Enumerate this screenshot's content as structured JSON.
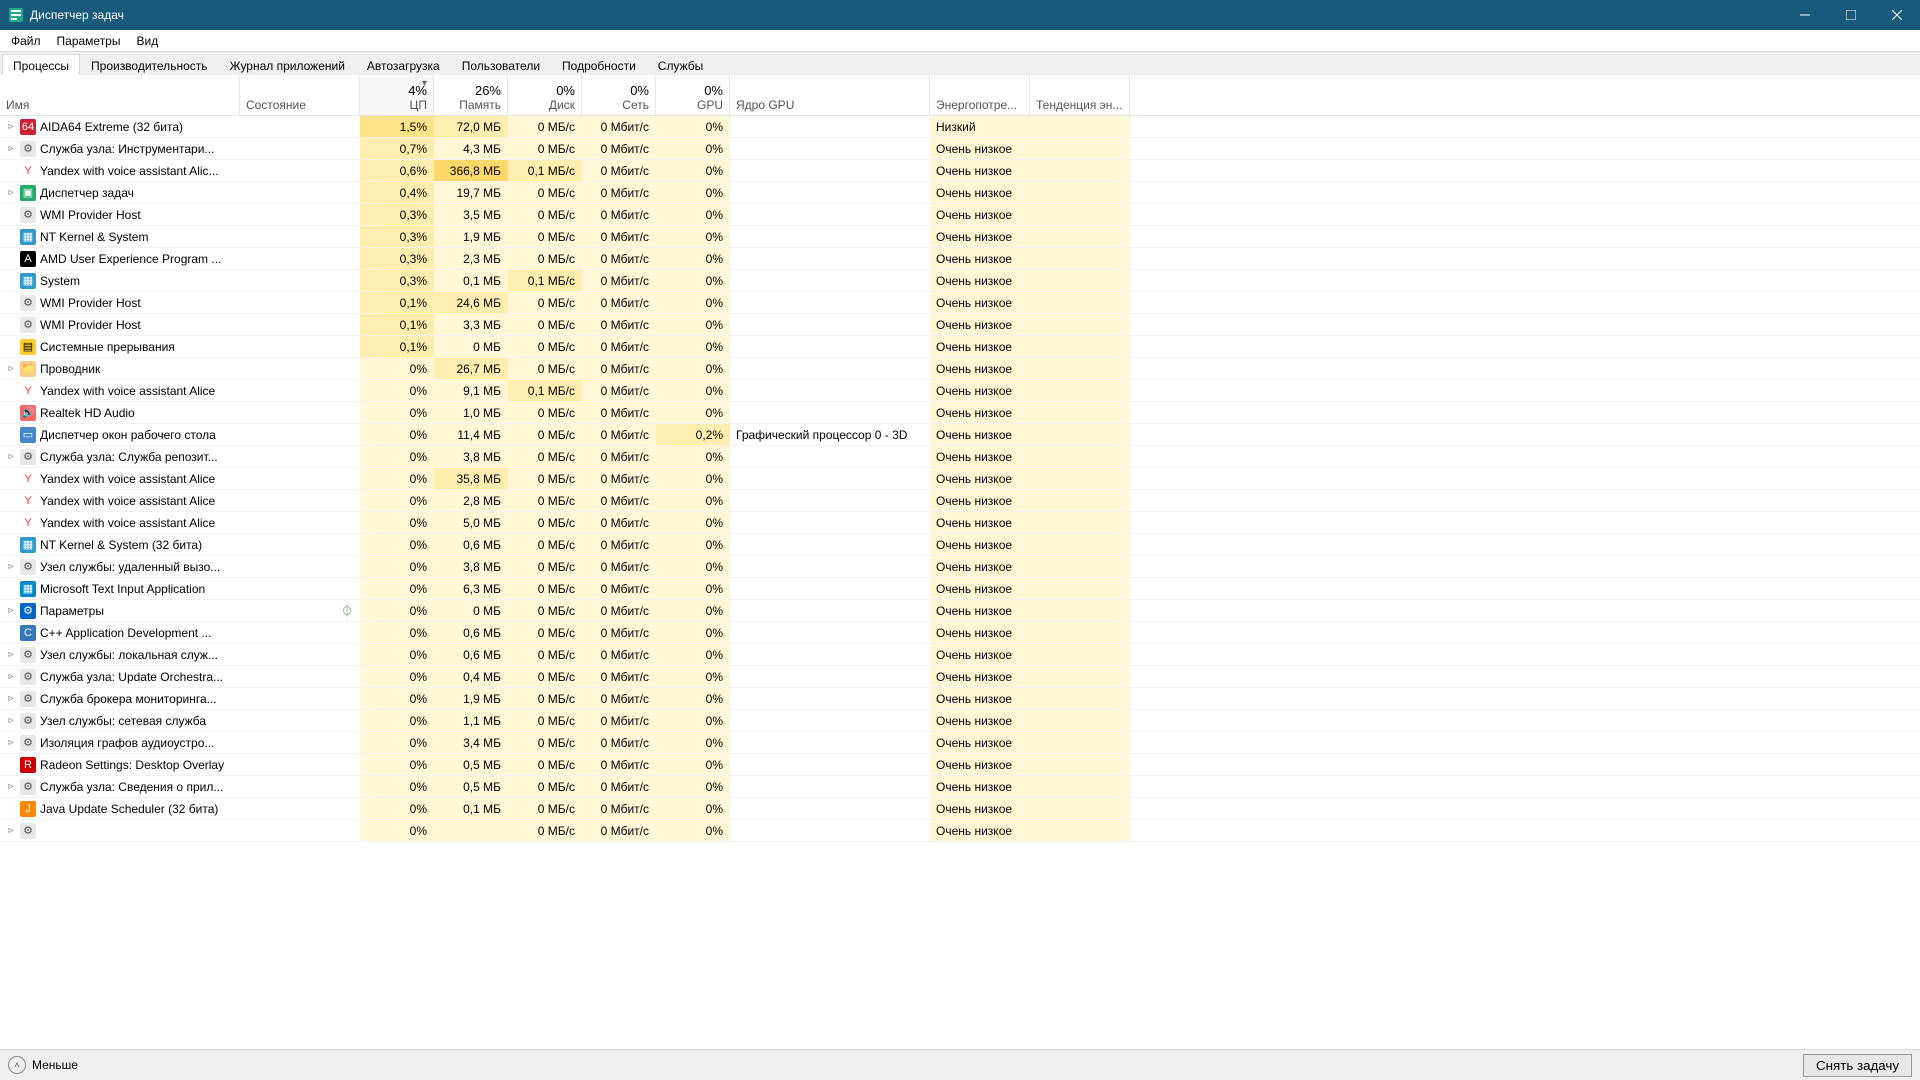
{
  "window": {
    "title": "Диспетчер задач"
  },
  "menu": {
    "file": "Файл",
    "options": "Параметры",
    "view": "Вид"
  },
  "tabs": {
    "processes": "Процессы",
    "performance": "Производительность",
    "app_history": "Журнал приложений",
    "startup": "Автозагрузка",
    "users": "Пользователи",
    "details": "Подробности",
    "services": "Службы"
  },
  "columns": {
    "name": "Имя",
    "status": "Состояние",
    "cpu_hdr": "4%",
    "cpu": "ЦП",
    "mem_hdr": "26%",
    "mem": "Память",
    "disk_hdr": "0%",
    "disk": "Диск",
    "net_hdr": "0%",
    "net": "Сеть",
    "gpu_hdr": "0%",
    "gpu": "GPU",
    "gpu_engine": "Ядро GPU",
    "power": "Энергопотре...",
    "trend": "Тенденция эн..."
  },
  "footer": {
    "fewer": "Меньше",
    "end_task": "Снять задачу"
  },
  "power_labels": {
    "low": "Низкий",
    "very_low": "Очень низкое"
  },
  "rows": [
    {
      "exp": true,
      "icon": "aida",
      "name": "AIDA64 Extreme (32 бита)",
      "cpu": "1,5%",
      "cpu_h": 2,
      "mem": "72,0 МБ",
      "mem_h": 1,
      "disk": "0 МБ/с",
      "net": "0 Мбит/с",
      "gpu": "0%",
      "gpueng": "",
      "pow": "low"
    },
    {
      "exp": true,
      "icon": "svc",
      "name": "Служба узла: Инструментари...",
      "cpu": "0,7%",
      "cpu_h": 1,
      "mem": "4,3 МБ",
      "disk": "0 МБ/с",
      "net": "0 Мбит/с",
      "gpu": "0%",
      "gpueng": "",
      "pow": "very_low"
    },
    {
      "exp": false,
      "icon": "yandex",
      "name": "Yandex with voice assistant Alic...",
      "cpu": "0,6%",
      "cpu_h": 1,
      "mem": "366,8 МБ",
      "mem_h": 3,
      "disk": "0,1 МБ/с",
      "disk_h": 1,
      "net": "0 Мбит/с",
      "gpu": "0%",
      "gpueng": "",
      "pow": "very_low"
    },
    {
      "exp": true,
      "icon": "tm",
      "name": "Диспетчер задач",
      "cpu": "0,4%",
      "cpu_h": 1,
      "mem": "19,7 МБ",
      "disk": "0 МБ/с",
      "net": "0 Мбит/с",
      "gpu": "0%",
      "gpueng": "",
      "pow": "very_low"
    },
    {
      "exp": false,
      "icon": "svc",
      "name": "WMI Provider Host",
      "cpu": "0,3%",
      "cpu_h": 1,
      "mem": "3,5 МБ",
      "disk": "0 МБ/с",
      "net": "0 Мбит/с",
      "gpu": "0%",
      "gpueng": "",
      "pow": "very_low"
    },
    {
      "exp": false,
      "icon": "sys",
      "name": "NT Kernel & System",
      "cpu": "0,3%",
      "cpu_h": 1,
      "mem": "1,9 МБ",
      "disk": "0 МБ/с",
      "net": "0 Мбит/с",
      "gpu": "0%",
      "gpueng": "",
      "pow": "very_low"
    },
    {
      "exp": false,
      "icon": "amd",
      "name": "AMD User Experience Program ...",
      "cpu": "0,3%",
      "cpu_h": 1,
      "mem": "2,3 МБ",
      "disk": "0 МБ/с",
      "net": "0 Мбит/с",
      "gpu": "0%",
      "gpueng": "",
      "pow": "very_low"
    },
    {
      "exp": false,
      "icon": "sys",
      "name": "System",
      "cpu": "0,3%",
      "cpu_h": 1,
      "mem": "0,1 МБ",
      "disk": "0,1 МБ/с",
      "disk_h": 1,
      "net": "0 Мбит/с",
      "gpu": "0%",
      "gpueng": "",
      "pow": "very_low"
    },
    {
      "exp": false,
      "icon": "svc",
      "name": "WMI Provider Host",
      "cpu": "0,1%",
      "cpu_h": 1,
      "mem": "24,6 МБ",
      "mem_h": 1,
      "disk": "0 МБ/с",
      "net": "0 Мбит/с",
      "gpu": "0%",
      "gpueng": "",
      "pow": "very_low"
    },
    {
      "exp": false,
      "icon": "svc",
      "name": "WMI Provider Host",
      "cpu": "0,1%",
      "cpu_h": 1,
      "mem": "3,3 МБ",
      "disk": "0 МБ/с",
      "net": "0 Мбит/с",
      "gpu": "0%",
      "gpueng": "",
      "pow": "very_low"
    },
    {
      "exp": false,
      "icon": "int",
      "name": "Системные прерывания",
      "cpu": "0,1%",
      "cpu_h": 1,
      "mem": "0 МБ",
      "disk": "0 МБ/с",
      "net": "0 Мбит/с",
      "gpu": "0%",
      "gpueng": "",
      "pow": "very_low"
    },
    {
      "exp": true,
      "icon": "explorer",
      "name": "Проводник",
      "cpu": "0%",
      "mem": "26,7 МБ",
      "mem_h": 1,
      "disk": "0 МБ/с",
      "net": "0 Мбит/с",
      "gpu": "0%",
      "gpueng": "",
      "pow": "very_low"
    },
    {
      "exp": false,
      "icon": "yandex",
      "name": "Yandex with voice assistant Alice",
      "cpu": "0%",
      "mem": "9,1 МБ",
      "disk": "0,1 МБ/с",
      "disk_h": 1,
      "net": "0 Мбит/с",
      "gpu": "0%",
      "gpueng": "",
      "pow": "very_low"
    },
    {
      "exp": false,
      "icon": "realtek",
      "name": "Realtek HD Audio",
      "cpu": "0%",
      "mem": "1,0 МБ",
      "disk": "0 МБ/с",
      "net": "0 Мбит/с",
      "gpu": "0%",
      "gpueng": "",
      "pow": "very_low"
    },
    {
      "exp": false,
      "icon": "dwm",
      "name": "Диспетчер окон рабочего стола",
      "cpu": "0%",
      "mem": "11,4 МБ",
      "disk": "0 МБ/с",
      "net": "0 Мбит/с",
      "gpu": "0,2%",
      "gpu_h": 1,
      "gpueng": "Графический процессор 0 - 3D",
      "pow": "very_low"
    },
    {
      "exp": true,
      "icon": "svc",
      "name": "Служба узла: Служба репозит...",
      "cpu": "0%",
      "mem": "3,8 МБ",
      "disk": "0 МБ/с",
      "net": "0 Мбит/с",
      "gpu": "0%",
      "gpueng": "",
      "pow": "very_low"
    },
    {
      "exp": false,
      "icon": "yandex",
      "name": "Yandex with voice assistant Alice",
      "cpu": "0%",
      "mem": "35,8 МБ",
      "mem_h": 1,
      "disk": "0 МБ/с",
      "net": "0 Мбит/с",
      "gpu": "0%",
      "gpueng": "",
      "pow": "very_low"
    },
    {
      "exp": false,
      "icon": "yandex",
      "name": "Yandex with voice assistant Alice",
      "cpu": "0%",
      "mem": "2,8 МБ",
      "disk": "0 МБ/с",
      "net": "0 Мбит/с",
      "gpu": "0%",
      "gpueng": "",
      "pow": "very_low"
    },
    {
      "exp": false,
      "icon": "yandex",
      "name": "Yandex with voice assistant Alice",
      "cpu": "0%",
      "mem": "5,0 МБ",
      "disk": "0 МБ/с",
      "net": "0 Мбит/с",
      "gpu": "0%",
      "gpueng": "",
      "pow": "very_low"
    },
    {
      "exp": false,
      "icon": "sys",
      "name": "NT Kernel & System (32 бита)",
      "cpu": "0%",
      "mem": "0,6 МБ",
      "disk": "0 МБ/с",
      "net": "0 Мбит/с",
      "gpu": "0%",
      "gpueng": "",
      "pow": "very_low"
    },
    {
      "exp": true,
      "icon": "svc",
      "name": "Узел службы: удаленный вызо...",
      "cpu": "0%",
      "mem": "3,8 МБ",
      "disk": "0 МБ/с",
      "net": "0 Мбит/с",
      "gpu": "0%",
      "gpueng": "",
      "pow": "very_low"
    },
    {
      "exp": false,
      "icon": "ms",
      "name": "Microsoft Text Input Application",
      "cpu": "0%",
      "mem": "6,3 МБ",
      "disk": "0 МБ/с",
      "net": "0 Мбит/с",
      "gpu": "0%",
      "gpueng": "",
      "pow": "very_low"
    },
    {
      "exp": true,
      "icon": "settings",
      "name": "Параметры",
      "leaf": true,
      "cpu": "0%",
      "mem": "0 МБ",
      "disk": "0 МБ/с",
      "net": "0 Мбит/с",
      "gpu": "0%",
      "gpueng": "",
      "pow": "very_low"
    },
    {
      "exp": false,
      "icon": "cpp",
      "name": "C++ Application Development ...",
      "cpu": "0%",
      "mem": "0,6 МБ",
      "disk": "0 МБ/с",
      "net": "0 Мбит/с",
      "gpu": "0%",
      "gpueng": "",
      "pow": "very_low"
    },
    {
      "exp": true,
      "icon": "svc",
      "name": "Узел службы: локальная служ...",
      "cpu": "0%",
      "mem": "0,6 МБ",
      "disk": "0 МБ/с",
      "net": "0 Мбит/с",
      "gpu": "0%",
      "gpueng": "",
      "pow": "very_low"
    },
    {
      "exp": true,
      "icon": "svc",
      "name": "Служба узла: Update Orchestra...",
      "cpu": "0%",
      "mem": "0,4 МБ",
      "disk": "0 МБ/с",
      "net": "0 Мбит/с",
      "gpu": "0%",
      "gpueng": "",
      "pow": "very_low"
    },
    {
      "exp": true,
      "icon": "svc",
      "name": "Служба брокера мониторинга...",
      "cpu": "0%",
      "mem": "1,9 МБ",
      "disk": "0 МБ/с",
      "net": "0 Мбит/с",
      "gpu": "0%",
      "gpueng": "",
      "pow": "very_low"
    },
    {
      "exp": true,
      "icon": "svc",
      "name": "Узел службы: сетевая служба",
      "cpu": "0%",
      "mem": "1,1 МБ",
      "disk": "0 МБ/с",
      "net": "0 Мбит/с",
      "gpu": "0%",
      "gpueng": "",
      "pow": "very_low"
    },
    {
      "exp": true,
      "icon": "svc",
      "name": "Изоляция графов аудиоустро...",
      "cpu": "0%",
      "mem": "3,4 МБ",
      "disk": "0 МБ/с",
      "net": "0 Мбит/с",
      "gpu": "0%",
      "gpueng": "",
      "pow": "very_low"
    },
    {
      "exp": false,
      "icon": "radeon",
      "name": "Radeon Settings: Desktop Overlay",
      "cpu": "0%",
      "mem": "0,5 МБ",
      "disk": "0 МБ/с",
      "net": "0 Мбит/с",
      "gpu": "0%",
      "gpueng": "",
      "pow": "very_low"
    },
    {
      "exp": true,
      "icon": "svc",
      "name": "Служба узла: Сведения о прил...",
      "cpu": "0%",
      "mem": "0,5 МБ",
      "disk": "0 МБ/с",
      "net": "0 Мбит/с",
      "gpu": "0%",
      "gpueng": "",
      "pow": "very_low"
    },
    {
      "exp": false,
      "icon": "java",
      "name": "Java Update Scheduler (32 бита)",
      "cpu": "0%",
      "mem": "0,1 МБ",
      "disk": "0 МБ/с",
      "net": "0 Мбит/с",
      "gpu": "0%",
      "gpueng": "",
      "pow": "very_low"
    },
    {
      "exp": true,
      "icon": "svc",
      "name": "",
      "cpu": "0%",
      "mem": "",
      "disk": "0 МБ/с",
      "net": "0 Мбит/с",
      "gpu": "0%",
      "gpueng": "",
      "pow": "very_low"
    }
  ],
  "icons": {
    "aida": {
      "bg": "#c23",
      "fg": "#fff",
      "txt": "64"
    },
    "svc": {
      "bg": "#e8e8e8",
      "fg": "#555",
      "txt": "⚙"
    },
    "yandex": {
      "bg": "#fff",
      "fg": "#f33",
      "txt": "Y"
    },
    "tm": {
      "bg": "#2a6",
      "fg": "#fff",
      "txt": "▣"
    },
    "sys": {
      "bg": "#39c",
      "fg": "#fff",
      "txt": "▦"
    },
    "amd": {
      "bg": "#000",
      "fg": "#fff",
      "txt": "A"
    },
    "int": {
      "bg": "#fc3",
      "fg": "#000",
      "txt": "▤"
    },
    "explorer": {
      "bg": "#fc8",
      "fg": "#b60",
      "txt": "📁"
    },
    "realtek": {
      "bg": "#f66",
      "fg": "#fff",
      "txt": "🔊"
    },
    "dwm": {
      "bg": "#48c",
      "fg": "#fff",
      "txt": "▭"
    },
    "ms": {
      "bg": "#08c",
      "fg": "#fff",
      "txt": "▦"
    },
    "settings": {
      "bg": "#06c",
      "fg": "#fff",
      "txt": "⚙"
    },
    "cpp": {
      "bg": "#37b",
      "fg": "#fff",
      "txt": "C"
    },
    "radeon": {
      "bg": "#c00",
      "fg": "#fff",
      "txt": "R"
    },
    "java": {
      "bg": "#f80",
      "fg": "#fff",
      "txt": "J"
    }
  }
}
